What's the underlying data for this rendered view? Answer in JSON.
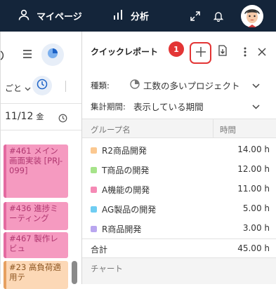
{
  "topbar": {
    "mypage_label": "マイページ",
    "analysis_label": "分析"
  },
  "left": {
    "date_label": "11/12",
    "weekday_label": "金",
    "filter_partial": "ごと",
    "events": [
      "#461 メイン画面実装 [PRJ-099]",
      "#436 進捗ミーティング",
      "#467 製作レビュ",
      "#23 高負荷適用テ"
    ]
  },
  "panel": {
    "title": "クイックレポート",
    "badge": "1",
    "type_label": "種類:",
    "type_value": "工数の多いプロジェクト",
    "period_label": "集計期間:",
    "period_value": "表示している期間",
    "col_group": "グループ名",
    "col_hours": "時間",
    "rows": [
      {
        "name": "R2商品開発",
        "hours": "14.00 h",
        "color": "#fbc890"
      },
      {
        "name": "T商品の開発",
        "hours": "12.00 h",
        "color": "#a6e38a"
      },
      {
        "name": "A機能の開発",
        "hours": "11.00 h",
        "color": "#f58ab5"
      },
      {
        "name": "AG製品の開発",
        "hours": "5.00 h",
        "color": "#6fcdf2"
      },
      {
        "name": "R商品開発",
        "hours": "3.00 h",
        "color": "#b9a6ef"
      }
    ],
    "total_label": "合計",
    "total_hours": "45.00 h",
    "chart_label": "チャート"
  }
}
